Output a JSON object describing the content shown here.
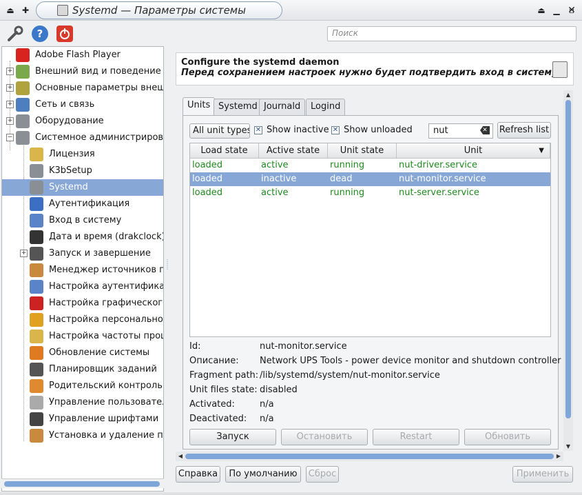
{
  "window": {
    "title": "Systemd — Параметры системы"
  },
  "toolbar": {
    "search_placeholder": "Поиск"
  },
  "sidebar": {
    "items": [
      {
        "label": "Adobe Flash Player",
        "icon": "flash-icon",
        "color": "#d8231e"
      },
      {
        "label": "Внешний вид и поведение с",
        "icon": "appearance-icon",
        "color": "#7aa84a"
      },
      {
        "label": "Основные параметры внеш",
        "icon": "basic-settings-icon",
        "color": "#b0a23c"
      },
      {
        "label": "Сеть и связь",
        "icon": "network-icon",
        "color": "#4d7fc0"
      },
      {
        "label": "Оборудование",
        "icon": "hardware-icon",
        "color": "#8a8f96"
      },
      {
        "label": "Системное администрирова",
        "icon": "system-admin-icon",
        "color": "#8a8f96"
      },
      {
        "label": "Лицензия",
        "icon": "license-icon",
        "color": "#d9b54a"
      },
      {
        "label": "K3bSetup",
        "icon": "k3b-icon",
        "color": "#8a8f96"
      },
      {
        "label": "Systemd",
        "icon": "systemd-icon",
        "color": "#8a8f96"
      },
      {
        "label": "Аутентификация",
        "icon": "authentication-icon",
        "color": "#3a6fc4"
      },
      {
        "label": "Вход в систему",
        "icon": "login-icon",
        "color": "#5a84c7"
      },
      {
        "label": "Дата и время (drakclock)",
        "icon": "clock-icon",
        "color": "#333333"
      },
      {
        "label": "Запуск и завершение",
        "icon": "startup-icon",
        "color": "#555555"
      },
      {
        "label": "Менеджер источников пр",
        "icon": "sources-manager-icon",
        "color": "#c98a3d"
      },
      {
        "label": "Настройка аутентификац",
        "icon": "auth-config-icon",
        "color": "#5a84c7"
      },
      {
        "label": "Настройка графического",
        "icon": "graphics-config-icon",
        "color": "#cc2222"
      },
      {
        "label": "Настройка персонального",
        "icon": "firewall-icon",
        "color": "#e0a020"
      },
      {
        "label": "Настройка частоты проце",
        "icon": "cpu-frequency-icon",
        "color": "#d9b54a"
      },
      {
        "label": "Обновление системы",
        "icon": "update-icon",
        "color": "#e07a20"
      },
      {
        "label": "Планировщик заданий",
        "icon": "scheduler-icon",
        "color": "#555555"
      },
      {
        "label": "Родительский контроль",
        "icon": "parental-control-icon",
        "color": "#e08a30"
      },
      {
        "label": "Управление пользовател",
        "icon": "users-icon",
        "color": "#aaaaaa"
      },
      {
        "label": "Управление шрифтами",
        "icon": "fonts-icon",
        "color": "#444444"
      },
      {
        "label": "Установка и удаление пр",
        "icon": "install-remove-icon",
        "color": "#c98a3d"
      }
    ],
    "selected_index": 8
  },
  "header": {
    "title": "Configure the systemd daemon",
    "subtitle": "Перед сохранением настроек нужно будет подтвердить вход в систему"
  },
  "tabs": [
    {
      "label": "Units",
      "active": true
    },
    {
      "label": "Systemd",
      "active": false
    },
    {
      "label": "Journald",
      "active": false
    },
    {
      "label": "Logind",
      "active": false
    }
  ],
  "filters": {
    "unit_type": "All unit types",
    "show_inactive_label": "Show inactive",
    "show_inactive_checked": true,
    "show_unloaded_label": "Show unloaded",
    "show_unloaded_checked": true,
    "search_value": "nut",
    "refresh_label": "Refresh list"
  },
  "table": {
    "columns": [
      "Load state",
      "Active state",
      "Unit state",
      "Unit"
    ],
    "rows": [
      {
        "load": "loaded",
        "active": "active",
        "unit_state": "running",
        "unit": "nut-driver.service",
        "selected": false
      },
      {
        "load": "loaded",
        "active": "inactive",
        "unit_state": "dead",
        "unit": "nut-monitor.service",
        "selected": true
      },
      {
        "load": "loaded",
        "active": "active",
        "unit_state": "running",
        "unit": "nut-server.service",
        "selected": false
      }
    ]
  },
  "details": [
    {
      "label": "Id:",
      "value": "nut-monitor.service"
    },
    {
      "label": "Описание:",
      "value": "Network UPS Tools - power device monitor and shutdown controller"
    },
    {
      "label": "Fragment path:",
      "value": "/lib/systemd/system/nut-monitor.service"
    },
    {
      "label": "Unit files state:",
      "value": "disabled"
    },
    {
      "label": "Activated:",
      "value": "n/a"
    },
    {
      "label": "Deactivated:",
      "value": "n/a"
    }
  ],
  "actions": {
    "start": "Запуск",
    "stop": "Остановить",
    "restart": "Restart",
    "reload": "Обновить"
  },
  "footer": {
    "help": "Справка",
    "defaults": "По умолчанию",
    "reset": "Сброс",
    "apply": "Применить"
  },
  "colors": {
    "selection": "#87a8d7",
    "ok_text": "#1f8a1f",
    "scroll_thumb": "#7fa6d8"
  }
}
